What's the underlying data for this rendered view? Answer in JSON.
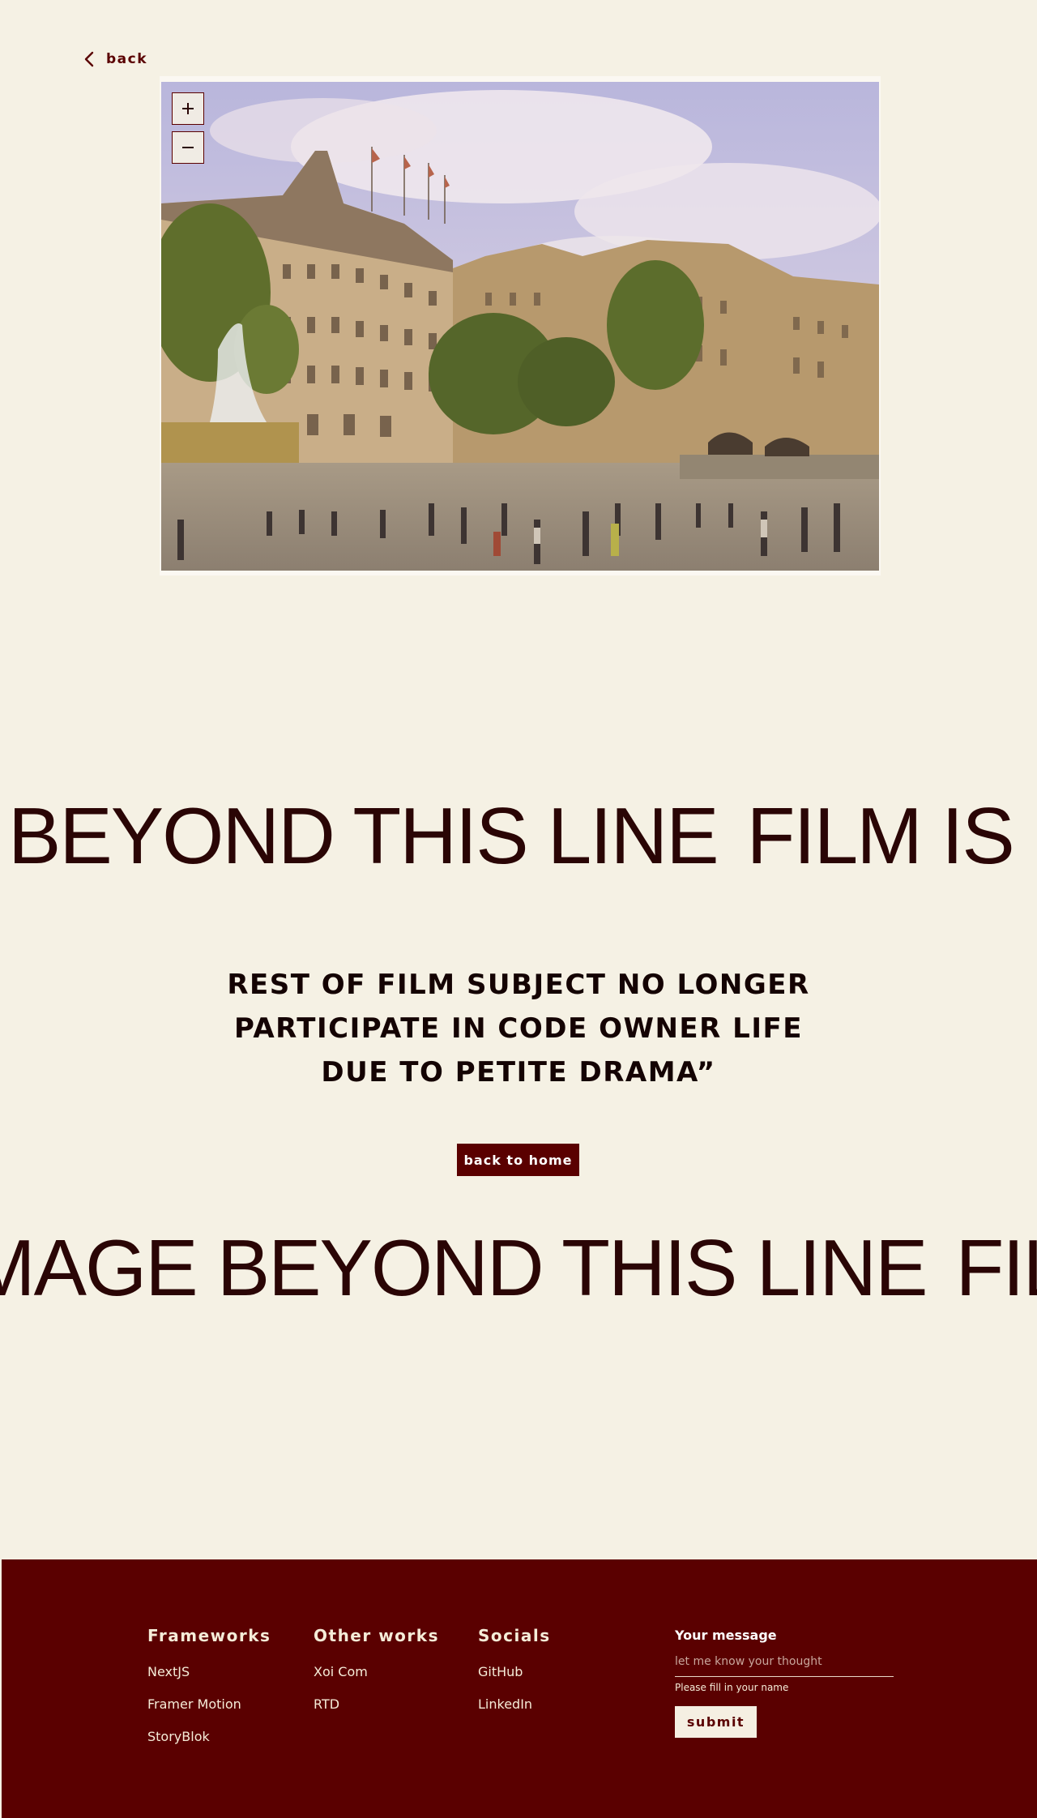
{
  "nav": {
    "back_label": "back"
  },
  "photo": {
    "alt": "Trafalgar Square, London"
  },
  "zoom": {
    "in_label": "+",
    "out_label": "−"
  },
  "marquee_top": [
    "BEYOND THIS LINE",
    "FILM IS NOT"
  ],
  "quote": {
    "lines": [
      "REST OF FILM SUBJECT NO LONGER",
      "PARTICIPATE IN CODE OWNER LIFE",
      "DUE TO PETITE DRAMA”"
    ]
  },
  "home_button": "back to home",
  "marquee_bottom": [
    "MAGE BEYOND THIS LINE",
    "FILM IS"
  ],
  "footer": {
    "columns": [
      {
        "title": "Frameworks",
        "links": [
          "NextJS",
          "Framer Motion",
          "StoryBlok"
        ]
      },
      {
        "title": "Other works",
        "links": [
          "Xoi Com",
          "RTD"
        ]
      },
      {
        "title": "Socials",
        "links": [
          "GitHub",
          "LinkedIn"
        ]
      }
    ],
    "message": {
      "label": "Your message",
      "placeholder": "let me know your thought",
      "value": "",
      "hint": "Please fill in your name",
      "submit_label": "submit"
    }
  },
  "colors": {
    "background": "#f5f1e4",
    "accent": "#5a0000",
    "text": "#2a0505"
  }
}
